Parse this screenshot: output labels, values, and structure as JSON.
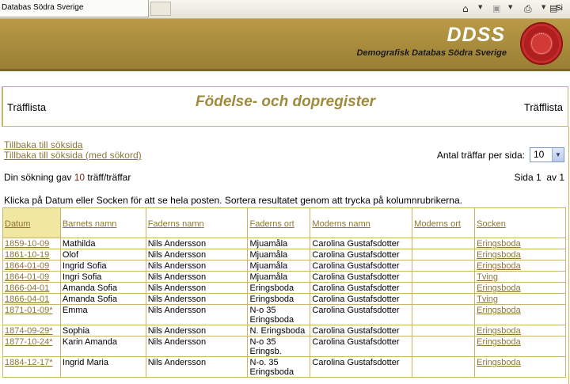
{
  "browser": {
    "tab_title": "Databas Södra Sverige",
    "toolbar_icons": [
      "home-icon",
      "feed-icon",
      "print-icon"
    ],
    "toolbar_label": "Si"
  },
  "banner": {
    "logo_text": "DDSS",
    "subtitle": "Demografisk Databas Södra Sverige",
    "seal_icon": "seal-emblem"
  },
  "titlebar": {
    "left": "Träfflista",
    "title": "Födelse- och dopregister",
    "right": "Träfflista"
  },
  "links": {
    "back": "Tillbaka till söksida",
    "back_with_keywords": "Tillbaka till söksida (med sökord)"
  },
  "perpage": {
    "label": "Antal träffar per sida:",
    "selected": "10"
  },
  "result": {
    "prefix": "Din sökning gav ",
    "count": "10",
    "suffix": " träff/träffar"
  },
  "pagination": {
    "text": "Sida 1  av 1"
  },
  "instruction": "Klicka på Datum eller Socken för att se hela posten. Sortera resultatet genom att trycka på kolumnrubrikerna.",
  "table": {
    "headers": [
      "Datum",
      "Barnets namn",
      "Faderns namn",
      "Faderns ort",
      "Moderns namn",
      "Moderns ort",
      "Socken"
    ],
    "rows": [
      {
        "datum": "1859-10-09",
        "barn": "Mathilda",
        "far": "Nils Andersson",
        "far_ort": "Mjuamåla",
        "mor": "Carolina Gustafsdotter",
        "mor_ort": "",
        "socken": "Eringsboda"
      },
      {
        "datum": "1861-10-19",
        "barn": "Olof",
        "far": "Nils Andersson",
        "far_ort": "Mjuamåla",
        "mor": "Carolina Gustafsdotter",
        "mor_ort": "",
        "socken": "Eringsboda"
      },
      {
        "datum": "1864-01-09",
        "barn": "Ingrid Sofia",
        "far": "Nils Andersson",
        "far_ort": "Mjuamåla",
        "mor": "Carolina Gustafsdotter",
        "mor_ort": "",
        "socken": "Eringsboda"
      },
      {
        "datum": "1864-01-09",
        "barn": "Ingri Sofia",
        "far": "Nils Andersson",
        "far_ort": "Mjuamåla",
        "mor": "Carolina Gustafsdotter",
        "mor_ort": "",
        "socken": "Tving"
      },
      {
        "datum": "1866-04-01",
        "barn": "Amanda Sofia",
        "far": "Nils Andersson",
        "far_ort": "Eringsboda",
        "mor": "Carolina Gustafsdotter",
        "mor_ort": "",
        "socken": "Eringsboda"
      },
      {
        "datum": "1866-04-01",
        "barn": "Amanda Sofia",
        "far": "Nils Andersson",
        "far_ort": "Eringsboda",
        "mor": "Carolina Gustafsdotter",
        "mor_ort": "",
        "socken": "Tving"
      },
      {
        "datum": "1871-01-09*",
        "barn": "Emma",
        "far": "Nils Andersson",
        "far_ort": "N-o 35\nEringsboda",
        "mor": "Carolina Gustafsdotter",
        "mor_ort": "",
        "socken": "Eringsboda"
      },
      {
        "datum": "1874-09-29*",
        "barn": "Sophia",
        "far": "Nils Andersson",
        "far_ort": "N. Eringsboda",
        "mor": "Carolina Gustafsdotter",
        "mor_ort": "",
        "socken": "Eringsboda"
      },
      {
        "datum": "1877-10-24*",
        "barn": "Karin Amanda",
        "far": "Nils Andersson",
        "far_ort": "N-o 35\nEringsb.",
        "mor": "Carolina Gustafsdotter",
        "mor_ort": "",
        "socken": "Eringsboda"
      },
      {
        "datum": "1884-12-17*",
        "barn": "Ingrid Maria",
        "far": "Nils Andersson",
        "far_ort": "N-o. 35\nEringsboda",
        "mor": "Carolina Gustafsdotter",
        "mor_ort": "",
        "socken": "Eringsboda"
      }
    ]
  },
  "colors": {
    "banner": "#a68a3b",
    "link": "#8b7637",
    "title": "#a08a3e",
    "active_header": "#f1e7a0",
    "count": "#8b2020"
  }
}
